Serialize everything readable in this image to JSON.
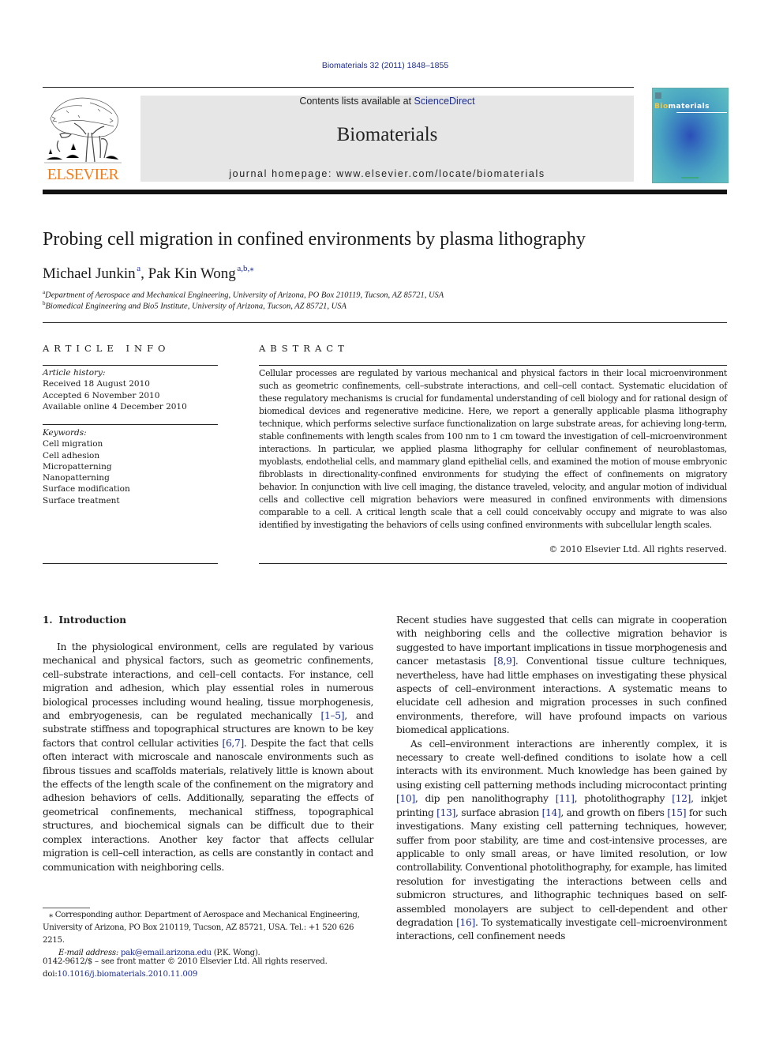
{
  "header": {
    "journal_ref": "Biomaterials 32 (2011) 1848–1855",
    "publisher_logo_text": "ELSEVIER",
    "contents_prefix": "Contents lists available at ",
    "contents_link": "ScienceDirect",
    "journal_title": "Biomaterials",
    "homepage": "journal homepage: www.elsevier.com/locate/biomaterials",
    "cover": {
      "title_highlight": "Bio",
      "title_rest": "materials",
      "highlight_color": "#f5c542"
    },
    "colors": {
      "link": "#1e2f8f",
      "elsevier_orange": "#f07e1c",
      "masthead_bg": "#e6e6e6"
    }
  },
  "article": {
    "title": "Probing cell migration in confined environments by plasma lithography",
    "authors": [
      {
        "name": "Michael Junkin",
        "sup": "a"
      },
      {
        "name": "Pak Kin Wong",
        "sup": "a,b,",
        "corresponding_mark": "⁎"
      }
    ],
    "author_separator": ", ",
    "affiliations": [
      {
        "mark": "a",
        "text": "Department of Aerospace and Mechanical Engineering, University of Arizona, PO Box 210119, Tucson, AZ 85721, USA"
      },
      {
        "mark": "b",
        "text": "Biomedical Engineering and Bio5 Institute, University of Arizona, Tucson, AZ 85721, USA"
      }
    ]
  },
  "article_info": {
    "heading": "ARTICLE INFO",
    "history_label": "Article history:",
    "history": [
      "Received 18 August 2010",
      "Accepted 6 November 2010",
      "Available online 4 December 2010"
    ],
    "keywords_label": "Keywords:",
    "keywords": [
      "Cell migration",
      "Cell adhesion",
      "Micropatterning",
      "Nanopatterning",
      "Surface modification",
      "Surface treatment"
    ]
  },
  "abstract": {
    "heading": "ABSTRACT",
    "text": "Cellular processes are regulated by various mechanical and physical factors in their local microenvironment such as geometric confinements, cell–substrate interactions, and cell–cell contact. Systematic elucidation of these regulatory mechanisms is crucial for fundamental understanding of cell biology and for rational design of biomedical devices and regenerative medicine. Here, we report a generally applicable plasma lithography technique, which performs selective surface functionalization on large substrate areas, for achieving long-term, stable confinements with length scales from 100 nm to 1 cm toward the investigation of cell–microenvironment interactions. In particular, we applied plasma lithography for cellular confinement of neuroblastomas, myoblasts, endothelial cells, and mammary gland epithelial cells, and examined the motion of mouse embryonic fibroblasts in directionality-confined environments for studying the effect of confinements on migratory behavior. In conjunction with live cell imaging, the distance traveled, velocity, and angular motion of individual cells and collective cell migration behaviors were measured in confined environments with dimensions comparable to a cell. A critical length scale that a cell could conceivably occupy and migrate to was also identified by investigating the behaviors of cells using confined environments with subcellular length scales.",
    "copyright": "© 2010 Elsevier Ltd. All rights reserved."
  },
  "introduction": {
    "number": "1.",
    "heading": "Introduction",
    "p1": {
      "a": "In the physiological environment, cells are regulated by various mechanical and physical factors, such as geometric confinements, cell–substrate interactions, and cell–cell contacts. For instance, cell migration and adhesion, which play essential roles in numerous biological processes including wound healing, tissue morphogenesis, and embryogenesis, can be regulated mechanically ",
      "ref1": "[1–5]",
      "b": ", and substrate stiffness and topographical structures are known to be key factors that control cellular activities ",
      "ref2": "[6,7]",
      "c": ". Despite the fact that cells often interact with microscale and nanoscale environments such as fibrous tissues and scaffolds materials, relatively little is known about the effects of the length scale of the confinement on the migratory and adhesion behaviors of cells. Additionally, separating the effects of geometrical confinements, mechanical stiffness, topographical structures, and biochemical signals can be difficult due to their complex interactions. Another key factor that affects cellular migration is cell–cell interaction, as cells are constantly in contact and communication with neighboring cells. "
    },
    "p1_cont": {
      "a": "Recent studies have suggested that cells can migrate in cooperation with neighboring cells and the collective migration behavior is suggested to have important implications in tissue morphogenesis and cancer metastasis ",
      "ref1": "[8,9]",
      "b": ". Conventional tissue culture techniques, nevertheless, have had little emphases on investigating these physical aspects of cell–environment interactions. A systematic means to elucidate cell adhesion and migration processes in such confined environments, therefore, will have profound impacts on various biomedical applications."
    },
    "p2": {
      "a": "As cell–environment interactions are inherently complex, it is necessary to create well-defined conditions to isolate how a cell interacts with its environment. Much knowledge has been gained by using existing cell patterning methods including microcontact printing ",
      "ref1": "[10]",
      "b": ", dip pen nanolithography ",
      "ref2": "[11]",
      "c": ", photolithography ",
      "ref3": "[12]",
      "d": ", inkjet printing ",
      "ref4": "[13]",
      "e": ", surface abrasion ",
      "ref5": "[14]",
      "f": ", and growth on fibers ",
      "ref6": "[15]",
      "g": " for such investigations. Many existing cell patterning techniques, however, suffer from poor stability, are time and cost-intensive processes, are applicable to only small areas, or have limited resolution, or low controllability. Conventional photolithography, for example, has limited resolution for investigating the interactions between cells and submicron structures, and lithographic techniques based on self-assembled monolayers are subject to cell-dependent and other degradation ",
      "ref7": "[16]",
      "h": ". To systematically investigate cell–microenvironment interactions, cell confinement needs"
    }
  },
  "footnote": {
    "mark": "⁎",
    "corresponding": " Corresponding author. Department of Aerospace and Mechanical Engineering, University of Arizona, PO Box 210119, Tucson, AZ 85721, USA. Tel.: +1 520 626 2215.",
    "email_label": "E-mail address:",
    "email": "pak@email.arizona.edu",
    "email_owner": " (P.K. Wong)."
  },
  "front_matter": {
    "issn_line": "0142-9612/$ – see front matter © 2010 Elsevier Ltd. All rights reserved.",
    "doi_prefix": "doi:",
    "doi": "10.1016/j.biomaterials.2010.11.009"
  }
}
